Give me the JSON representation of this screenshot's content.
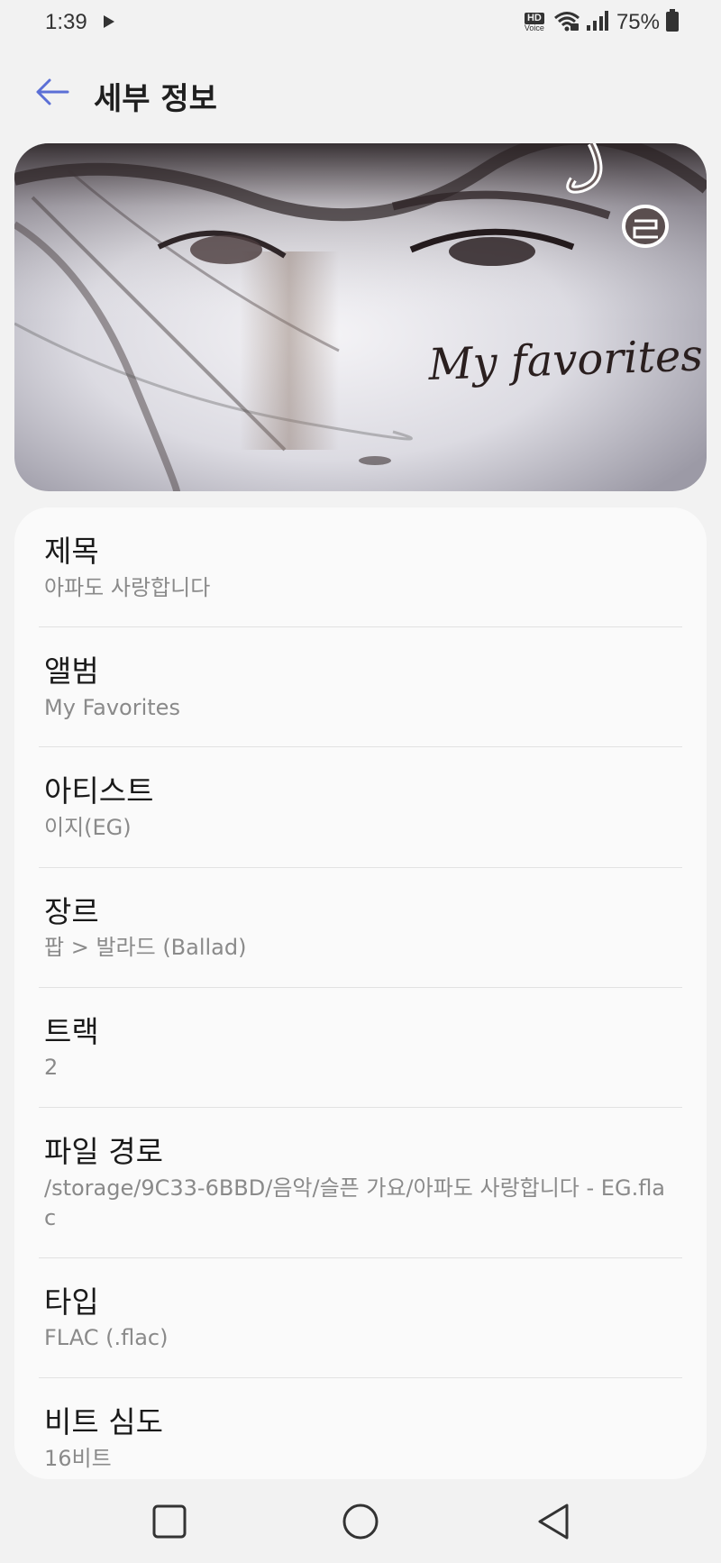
{
  "status_bar": {
    "time": "1:39",
    "hd_label": "HD",
    "voice_label": "Voice",
    "battery_percent": "75%",
    "icons": [
      "play-icon",
      "wifi-icon",
      "signal-icon",
      "battery-icon"
    ]
  },
  "app_bar": {
    "title": "세부 정보",
    "back_icon": "arrow-left-icon"
  },
  "album_art": {
    "caption": "My favorites"
  },
  "details": [
    {
      "label": "제목",
      "value": "아파도 사랑합니다"
    },
    {
      "label": "앨범",
      "value": "My Favorites"
    },
    {
      "label": "아티스트",
      "value": "이지(EG)"
    },
    {
      "label": "장르",
      "value": "팝 > 발라드 (Ballad)"
    },
    {
      "label": "트랙",
      "value": "2"
    },
    {
      "label": "파일 경로",
      "value": "/storage/9C33-6BBD/음악/슬픈 가요/아파도 사랑합니다 - EG.flac"
    },
    {
      "label": "타입",
      "value": "FLAC (.flac)"
    },
    {
      "label": "비트 심도",
      "value": "16비트"
    }
  ],
  "nav_bar": {
    "icons": [
      "recents-square-icon",
      "home-circle-icon",
      "back-triangle-icon"
    ]
  },
  "colors": {
    "accent": "#5b6fd6",
    "background": "#f2f2f2",
    "card": "#fafafa",
    "secondary_text": "#8a8a8a"
  }
}
